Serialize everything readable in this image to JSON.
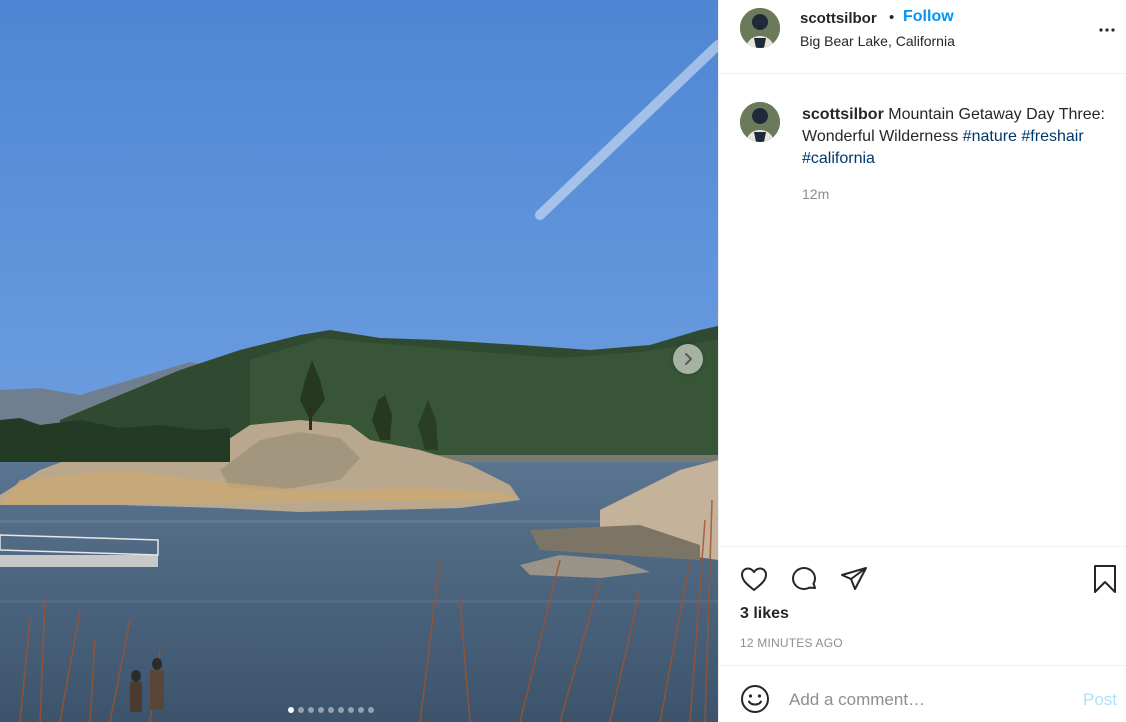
{
  "post": {
    "username": "scottsilbor",
    "separator": "•",
    "follow_label": "Follow",
    "location": "Big Bear Lake, California",
    "caption_user": "scottsilbor",
    "caption_text": "Mountain Getaway Day Three: Wonderful Wilderness",
    "hashtags": [
      "#nature",
      "#freshair",
      "#california"
    ],
    "time_ago": "12m",
    "likes": "3 likes",
    "posted_ago": "12 MINUTES AGO"
  },
  "comment": {
    "placeholder": "Add a comment…",
    "post_label": "Post"
  },
  "carousel": {
    "total": 9,
    "current": 1
  },
  "icons": {
    "more": "more-options-icon",
    "like": "heart-icon",
    "comment": "comment-bubble-icon",
    "share": "paper-plane-icon",
    "save": "bookmark-icon",
    "emoji": "emoji-smile-icon",
    "next": "chevron-right-icon"
  },
  "colors": {
    "accent": "#0095f6",
    "hashtag": "#00376b",
    "muted": "#8e8e8e",
    "post_disabled": "#b2dffc"
  }
}
